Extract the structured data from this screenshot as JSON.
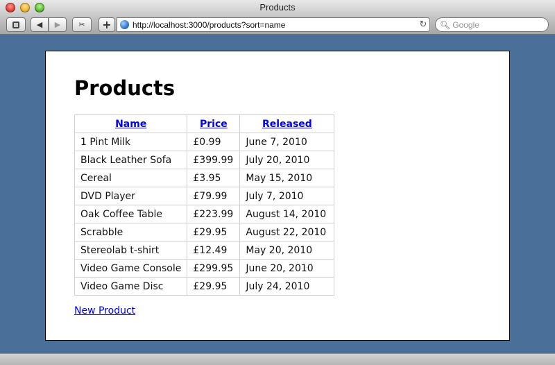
{
  "window": {
    "title": "Products"
  },
  "toolbar": {
    "bookmark_icon": "bookmarks-icon",
    "back_label": "◀",
    "forward_label": "▶",
    "snip_label": "✂",
    "add_label": "+",
    "url": "http://localhost:3000/products?sort=name",
    "reload_label": "↻",
    "search_placeholder": "Google"
  },
  "page": {
    "heading": "Products",
    "table": {
      "headers": [
        "Name",
        "Price",
        "Released"
      ],
      "rows": [
        [
          "1 Pint Milk",
          "£0.99",
          "June 7, 2010"
        ],
        [
          "Black Leather Sofa",
          "£399.99",
          "July 20, 2010"
        ],
        [
          "Cereal",
          "£3.95",
          "May 15, 2010"
        ],
        [
          "DVD Player",
          "£79.99",
          "July 7, 2010"
        ],
        [
          "Oak Coffee Table",
          "£223.99",
          "August 14, 2010"
        ],
        [
          "Scrabble",
          "£29.95",
          "August 22, 2010"
        ],
        [
          "Stereolab t-shirt",
          "£12.49",
          "May 20, 2010"
        ],
        [
          "Video Game Console",
          "£299.95",
          "June 20, 2010"
        ],
        [
          "Video Game Disc",
          "£29.95",
          "July 24, 2010"
        ]
      ]
    },
    "new_link": "New Product"
  },
  "colors": {
    "desktop": "#4a7099",
    "link": "#0000ee"
  }
}
